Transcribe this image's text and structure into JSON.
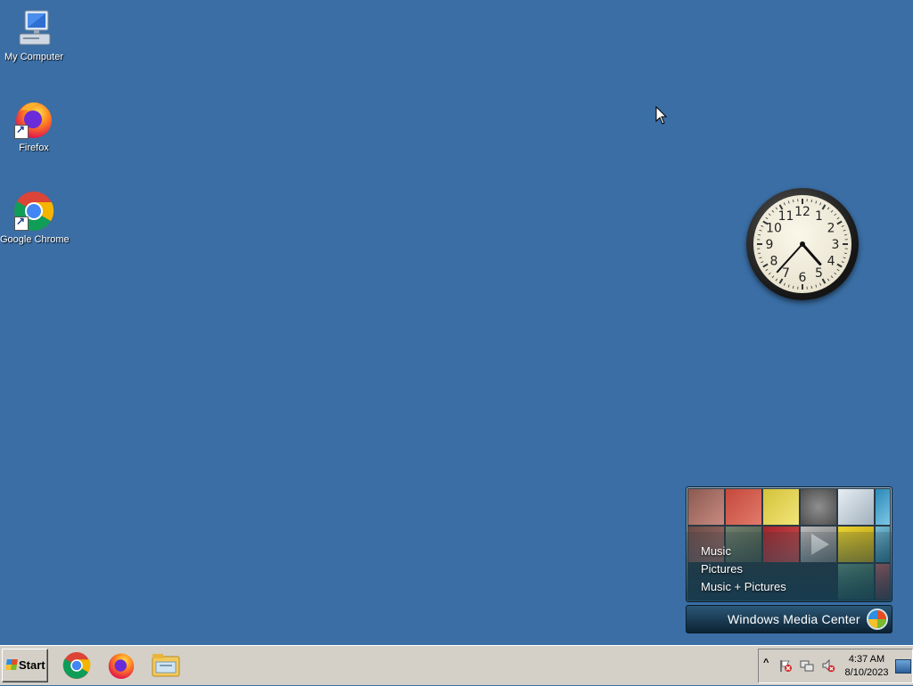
{
  "desktop": {
    "background": "#3a6ea5",
    "icons": [
      {
        "label": "My Computer",
        "icon": "my-computer-icon"
      },
      {
        "label": "Firefox",
        "icon": "firefox-icon"
      },
      {
        "label": "Google Chrome",
        "icon": "chrome-icon"
      }
    ]
  },
  "clock_gadget": {
    "numerals": [
      "12",
      "1",
      "2",
      "3",
      "4",
      "5",
      "6",
      "7",
      "8",
      "9",
      "10",
      "11"
    ],
    "time": "4:37"
  },
  "media_center_gadget": {
    "menu": [
      "Music",
      "Pictures",
      "Music + Pictures"
    ],
    "title_bold": "Windows",
    "title_rest": " Media Center"
  },
  "taskbar": {
    "start_label": "Start",
    "pinned_apps": [
      "chrome-icon",
      "firefox-icon",
      "file-explorer-icon"
    ],
    "tray": {
      "caret": "^",
      "icons": [
        "action-center-flag-icon",
        "network-icon",
        "volume-muted-icon"
      ],
      "time": "4:37 AM",
      "date": "8/10/2023"
    }
  }
}
